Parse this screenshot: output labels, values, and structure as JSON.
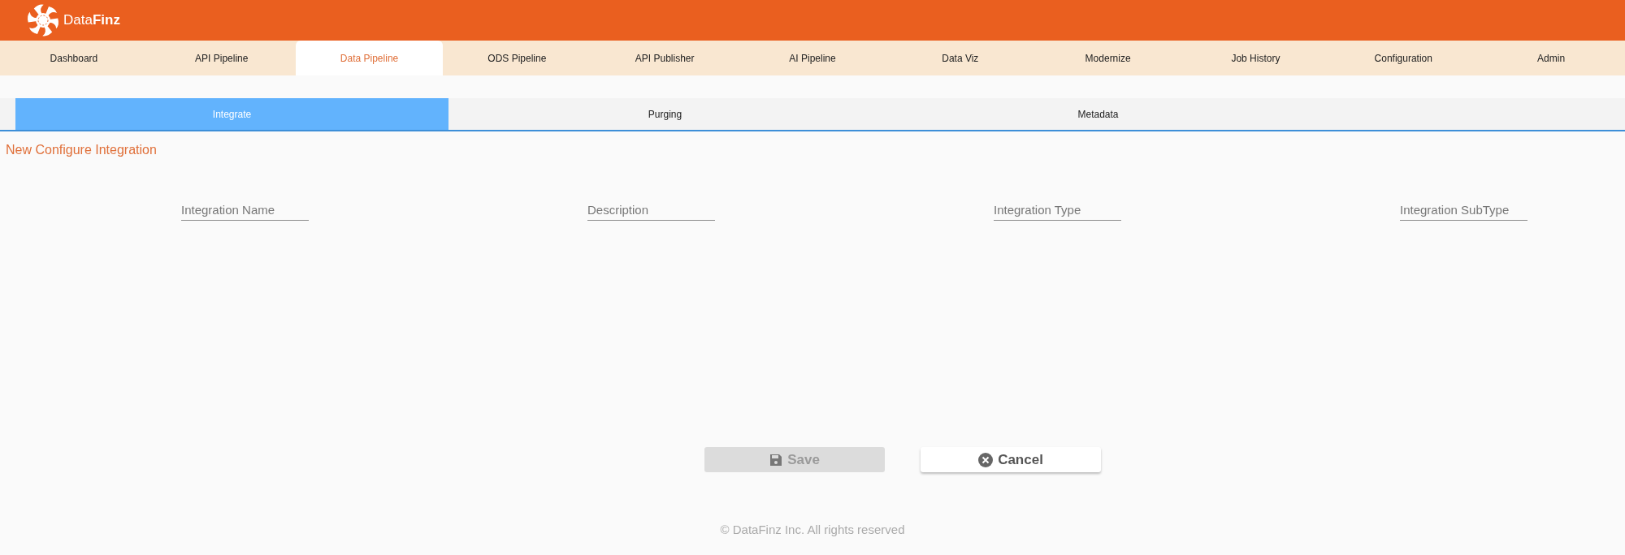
{
  "header": {
    "logo_text_light": "Data",
    "logo_text_bold": "Finz"
  },
  "nav": [
    {
      "label": "Dashboard",
      "selected": false
    },
    {
      "label": "API Pipeline",
      "selected": false
    },
    {
      "label": "Data Pipeline",
      "selected": true
    },
    {
      "label": "ODS Pipeline",
      "selected": false
    },
    {
      "label": "API Publisher",
      "selected": false
    },
    {
      "label": "AI Pipeline",
      "selected": false
    },
    {
      "label": "Data Viz",
      "selected": false
    },
    {
      "label": "Modernize",
      "selected": false
    },
    {
      "label": "Job History",
      "selected": false
    },
    {
      "label": "Configuration",
      "selected": false
    },
    {
      "label": "Admin",
      "selected": false
    }
  ],
  "subtabs": [
    {
      "label": "Integrate",
      "selected": true
    },
    {
      "label": "Purging",
      "selected": false
    },
    {
      "label": "Metadata",
      "selected": false
    }
  ],
  "form": {
    "title": "New Configure Integration",
    "fields": [
      {
        "placeholder": "Integration Name"
      },
      {
        "placeholder": "Description"
      },
      {
        "placeholder": "Integration Type"
      },
      {
        "placeholder": "Integration SubType"
      }
    ],
    "buttons": [
      {
        "kind": "save",
        "label": "Save",
        "disabled": true
      },
      {
        "kind": "cancel",
        "label": "Cancel",
        "disabled": false
      }
    ]
  },
  "footer": "© DataFinz Inc. All rights reserved"
}
